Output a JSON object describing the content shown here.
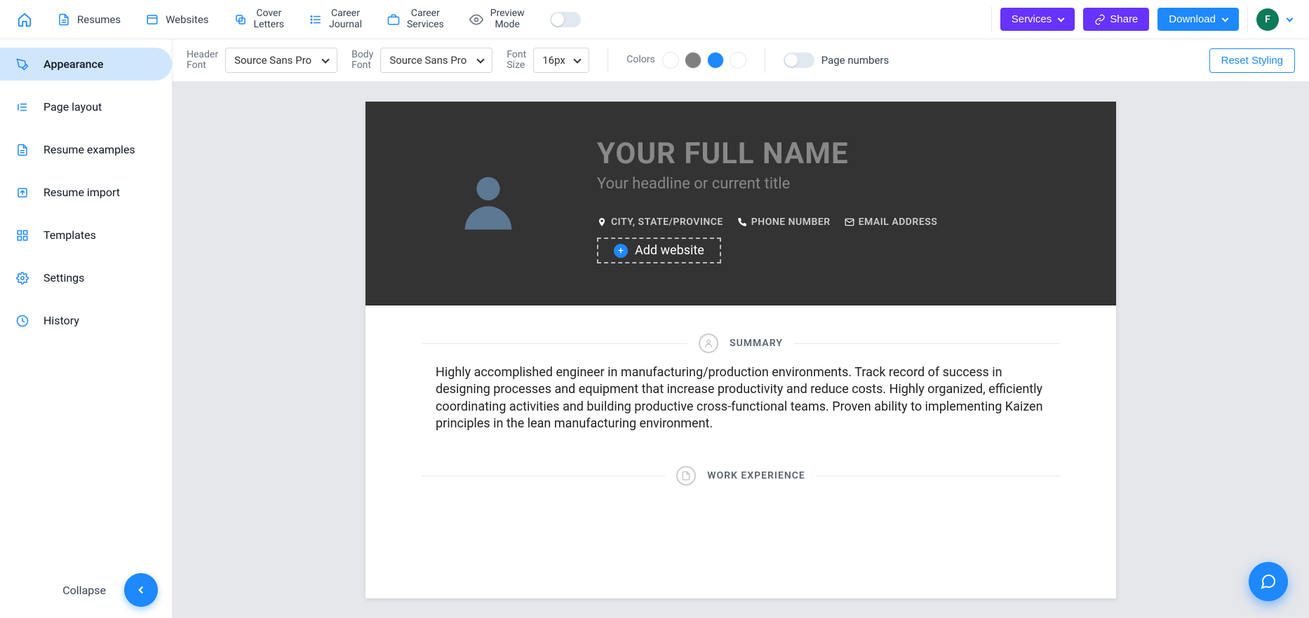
{
  "topnav": {
    "items": [
      {
        "label": "Resumes"
      },
      {
        "label": "Websites"
      },
      {
        "label": "Cover\nLetters"
      },
      {
        "label": "Career\nJournal"
      },
      {
        "label": "Career\nServices"
      },
      {
        "label": "Preview\nMode"
      }
    ],
    "services_label": "Services",
    "share_label": "Share",
    "download_label": "Download",
    "avatar_initial": "F"
  },
  "sidebar": {
    "items": [
      {
        "label": "Appearance"
      },
      {
        "label": "Page layout"
      },
      {
        "label": "Resume examples"
      },
      {
        "label": "Resume import"
      },
      {
        "label": "Templates"
      },
      {
        "label": "Settings"
      },
      {
        "label": "History"
      }
    ],
    "collapse_label": "Collapse"
  },
  "toolbar": {
    "header_font_label": "Header\nFont",
    "header_font_value": "Source Sans Pro",
    "body_font_label": "Body\nFont",
    "body_font_value": "Source Sans Pro",
    "font_size_label": "Font\nSize",
    "font_size_value": "16px",
    "colors_label": "Colors",
    "colors": [
      "#333333",
      "#808080",
      "#1e88ff",
      "#ffffff"
    ],
    "page_numbers_label": "Page numbers",
    "reset_label": "Reset Styling"
  },
  "resume": {
    "name": "YOUR FULL NAME",
    "headline": "Your headline or current title",
    "contacts": [
      {
        "label": "CITY, STATE/PROVINCE"
      },
      {
        "label": "PHONE NUMBER"
      },
      {
        "label": "EMAIL ADDRESS"
      }
    ],
    "add_website_label": "Add website",
    "section_summary_title": "SUMMARY",
    "summary_text": "Highly accomplished engineer in manufacturing/production environments. Track record of success in designing processes and equipment that increase productivity and reduce costs. Highly organized, efficiently coordinating activities and building productive cross-functional teams. Proven ability to implementing Kaizen principles in the lean manufacturing environment.",
    "section_work_title": "WORK EXPERIENCE"
  }
}
